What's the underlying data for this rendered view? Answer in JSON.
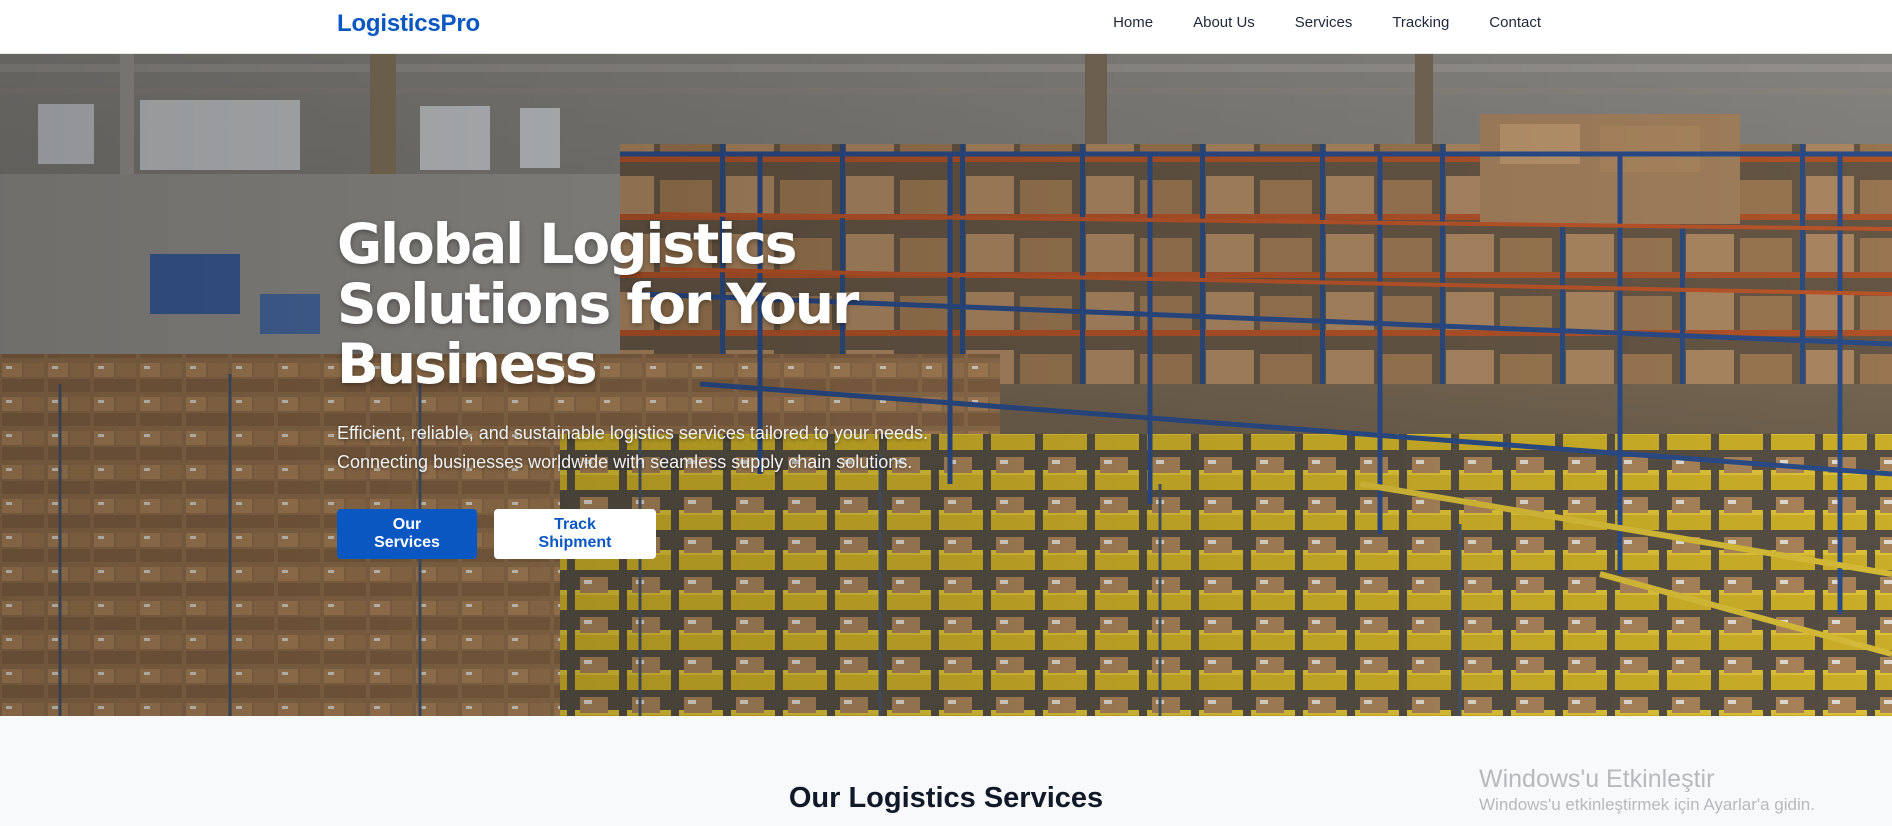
{
  "navbar": {
    "brand": "LogisticsPro",
    "links": [
      "Home",
      "About Us",
      "Services",
      "Tracking",
      "Contact"
    ]
  },
  "hero": {
    "title": "Global Logistics Solutions for Your Business",
    "subtitle_line1": "Efficient, reliable, and sustainable logistics services tailored to your needs.",
    "subtitle_line2": "Connecting businesses worldwide with seamless supply chain solutions.",
    "primary_button": "Our Services",
    "secondary_button": "Track Shipment"
  },
  "services": {
    "title": "Our Logistics Services"
  },
  "watermark": {
    "title": "Windows'u Etkinleştir",
    "subtitle": "Windows'u etkinleştirmek için Ayarlar'a gidin."
  },
  "colors": {
    "brand_blue": "#0b57c2",
    "text_dark": "#111827",
    "section_bg": "#f8f9fb"
  }
}
